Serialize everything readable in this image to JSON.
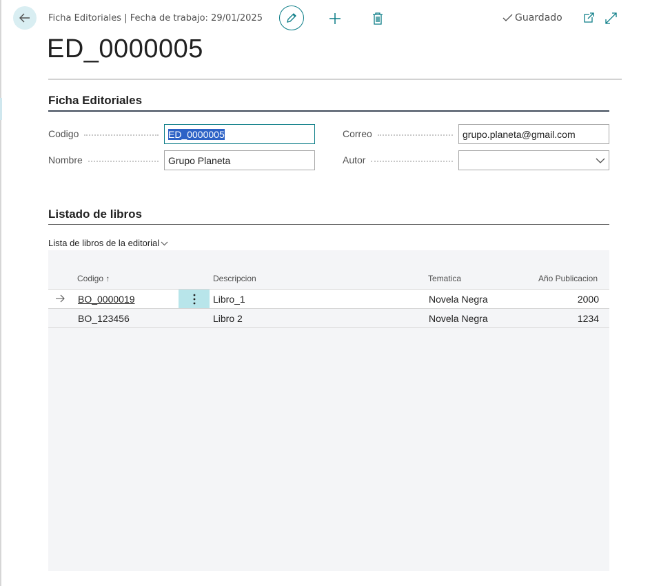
{
  "header": {
    "title": "Ficha Editoriales | Fecha de trabajo: 29/01/2025",
    "saved_label": "Guardado",
    "icons": [
      "back-arrow-icon",
      "pencil-icon",
      "plus-icon",
      "trash-icon",
      "checkmark-icon",
      "open-new-window-icon",
      "expand-icon"
    ],
    "accent_color": "#0a7c86"
  },
  "page": {
    "title": "ED_0000005"
  },
  "general": {
    "section_title": "Ficha Editoriales",
    "fields": {
      "codigo": {
        "label": "Codigo",
        "value": "ED_0000005"
      },
      "nombre": {
        "label": "Nombre",
        "value": "Grupo Planeta"
      },
      "correo": {
        "label": "Correo",
        "value": "grupo.planeta@gmail.com"
      },
      "autor": {
        "label": "Autor",
        "value": ""
      }
    }
  },
  "books": {
    "section_title": "Listado de libros",
    "list_caption": "Lista de libros de la editorial",
    "columns": {
      "codigo": "Codigo",
      "sort_indicator": "↑",
      "descripcion": "Descripcion",
      "tematica": "Tematica",
      "anio": "Año Publicacion"
    },
    "rows": [
      {
        "codigo": "BO_0000019",
        "descripcion": "Libro_1",
        "tematica": "Novela Negra",
        "anio": "2000"
      },
      {
        "codigo": "BO_123456",
        "descripcion": "Libro 2",
        "tematica": "Novela Negra",
        "anio": "1234"
      }
    ]
  }
}
